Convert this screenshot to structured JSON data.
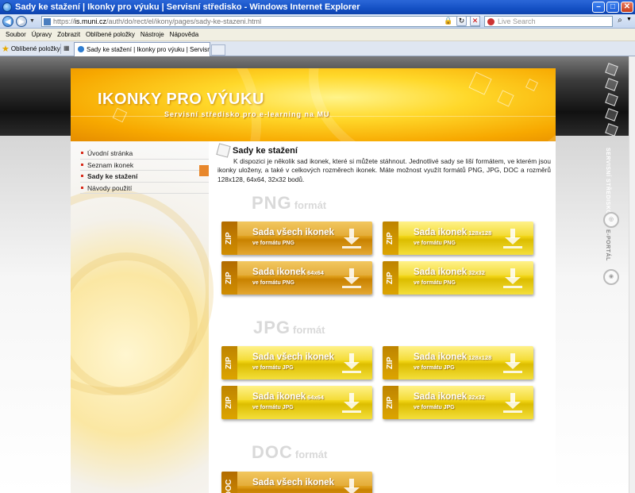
{
  "window": {
    "title": "Sady ke stažení | Ikonky pro výuku | Servisní středisko - Windows Internet Explorer",
    "minimize": "–",
    "maximize": "□",
    "close": "✕"
  },
  "address": {
    "url_prefix": "https://",
    "url_host": "is.muni.cz",
    "url_path": "/auth/do/rect/el/ikony/pages/sady-ke-stazeni.html",
    "search_placeholder": "Live Search"
  },
  "menu": [
    "Soubor",
    "Úpravy",
    "Zobrazit",
    "Oblíbené položky",
    "Nástroje",
    "Nápověda"
  ],
  "favorites_label": "Oblíbené položky",
  "tab_title": "Sady ke stažení | Ikonky pro výuku | Servisní středisko",
  "site": {
    "title": "IKONKY PRO VÝUKU",
    "subtitle": "Servisní středisko pro e-learning na MU",
    "nav": [
      "Úvodní stránka",
      "Seznam ikonek",
      "Sady ke stažení",
      "Návody použití"
    ],
    "side_label_1": "SERVISNÍ STŘEDISKO",
    "side_label_2": "E-PORTÁL"
  },
  "content": {
    "heading": "Sady ke stažení",
    "intro": "K dispozici je několik sad ikonek, které si můžete stáhnout. Jednotlivé sady se liší formátem, ve kterém jsou ikonky uloženy, a také v celkových rozměrech ikonek. Máte možnost využít formátů PNG, JPG, DOC a rozměrů 128x128, 64x64, 32x32 bodů.",
    "sections": [
      {
        "format": "PNG",
        "format_word": "formát",
        "buttons": [
          {
            "zip": "ZIP",
            "main": "Sada všech ikonek",
            "size": "",
            "sub": "ve formátu PNG"
          },
          {
            "zip": "ZIP",
            "main": "Sada ikonek",
            "size": "128x128",
            "sub": "ve formátu PNG"
          },
          {
            "zip": "ZIP",
            "main": "Sada ikonek",
            "size": "64x64",
            "sub": "ve formátu PNG"
          },
          {
            "zip": "ZIP",
            "main": "Sada ikonek",
            "size": "32x32",
            "sub": "ve formátu PNG"
          }
        ]
      },
      {
        "format": "JPG",
        "format_word": "formát",
        "buttons": [
          {
            "zip": "ZIP",
            "main": "Sada všech ikonek",
            "size": "",
            "sub": "ve formátu JPG"
          },
          {
            "zip": "ZIP",
            "main": "Sada ikonek",
            "size": "128x128",
            "sub": "ve formátu JPG"
          },
          {
            "zip": "ZIP",
            "main": "Sada ikonek",
            "size": "64x64",
            "sub": "ve formátu JPG"
          },
          {
            "zip": "ZIP",
            "main": "Sada ikonek",
            "size": "32x32",
            "sub": "ve formátu JPG"
          }
        ]
      },
      {
        "format": "DOC",
        "format_word": "formát",
        "buttons": [
          {
            "zip": "DOC",
            "main": "Sada všech ikonek",
            "size": "",
            "sub": ""
          }
        ]
      }
    ]
  }
}
